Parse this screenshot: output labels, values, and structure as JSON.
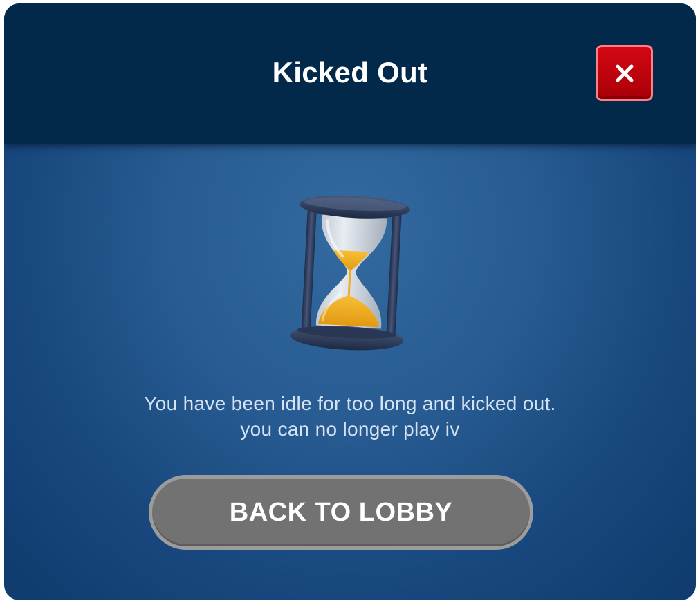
{
  "dialog": {
    "title": "Kicked Out",
    "close_icon": "close-icon",
    "illustration_icon": "hourglass-icon",
    "message_lines": [
      "You have been idle for too long and kicked out.",
      "you can no longer play iv"
    ],
    "primary_button_label": "BACK TO LOBBY"
  },
  "colors": {
    "header_background": "#02284a",
    "body_background": "#275b91",
    "close_button": "#c2020e",
    "close_button_border": "#ff7f86",
    "primary_button": "#727272",
    "primary_button_border": "#9c9c9c",
    "sand": "#f2ad1d"
  }
}
